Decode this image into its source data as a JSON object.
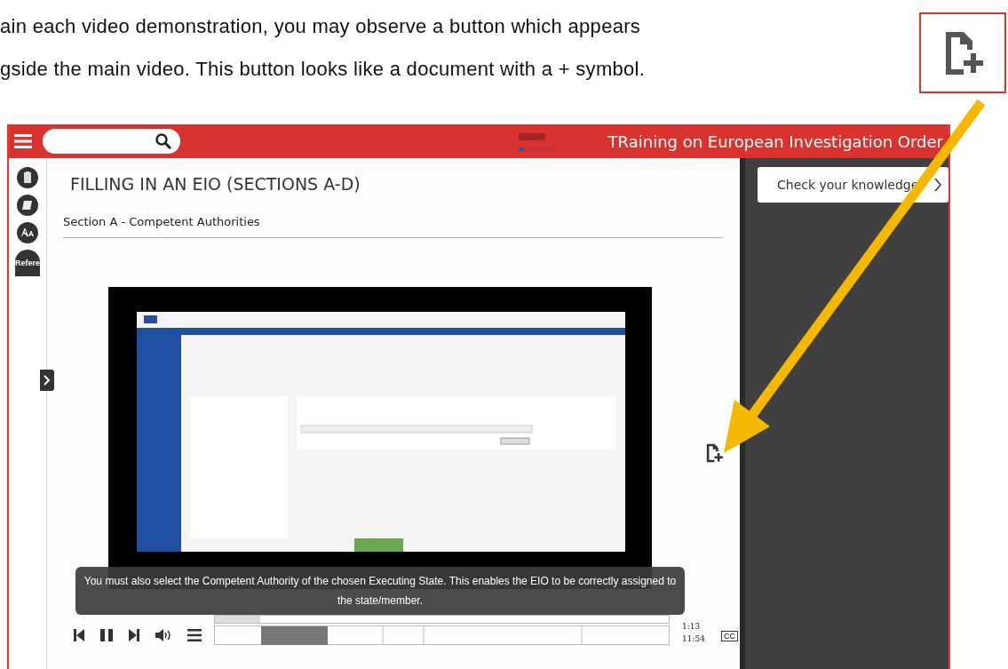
{
  "document_text": [
    "ain each video demonstration, you may observe a button which appears",
    "gside the main video. This button looks like a document with a + symbol."
  ],
  "app": {
    "header": {
      "title": "TRaining on European Investigation Order"
    },
    "tool_buttons": [
      {
        "kind": "clipboard"
      },
      {
        "kind": "book"
      },
      {
        "kind": "text-size"
      },
      {
        "kind": "label",
        "label": "Refere"
      }
    ],
    "page_title": "FILLING IN AN EIO (SECTIONS A-D)",
    "section_title": "Section A - Competent Authorities",
    "video": {
      "caption": "You must also select the Competent Authority of the chosen Executing State. This enables the EIO to be correctly assigned to the state/member.",
      "playing": true,
      "progress": {
        "level": 0.1
      },
      "current_time": "1:13",
      "duration": "11:54",
      "captions_button": "CC"
    },
    "side_panel": {
      "button": "Check your knowledge"
    }
  }
}
